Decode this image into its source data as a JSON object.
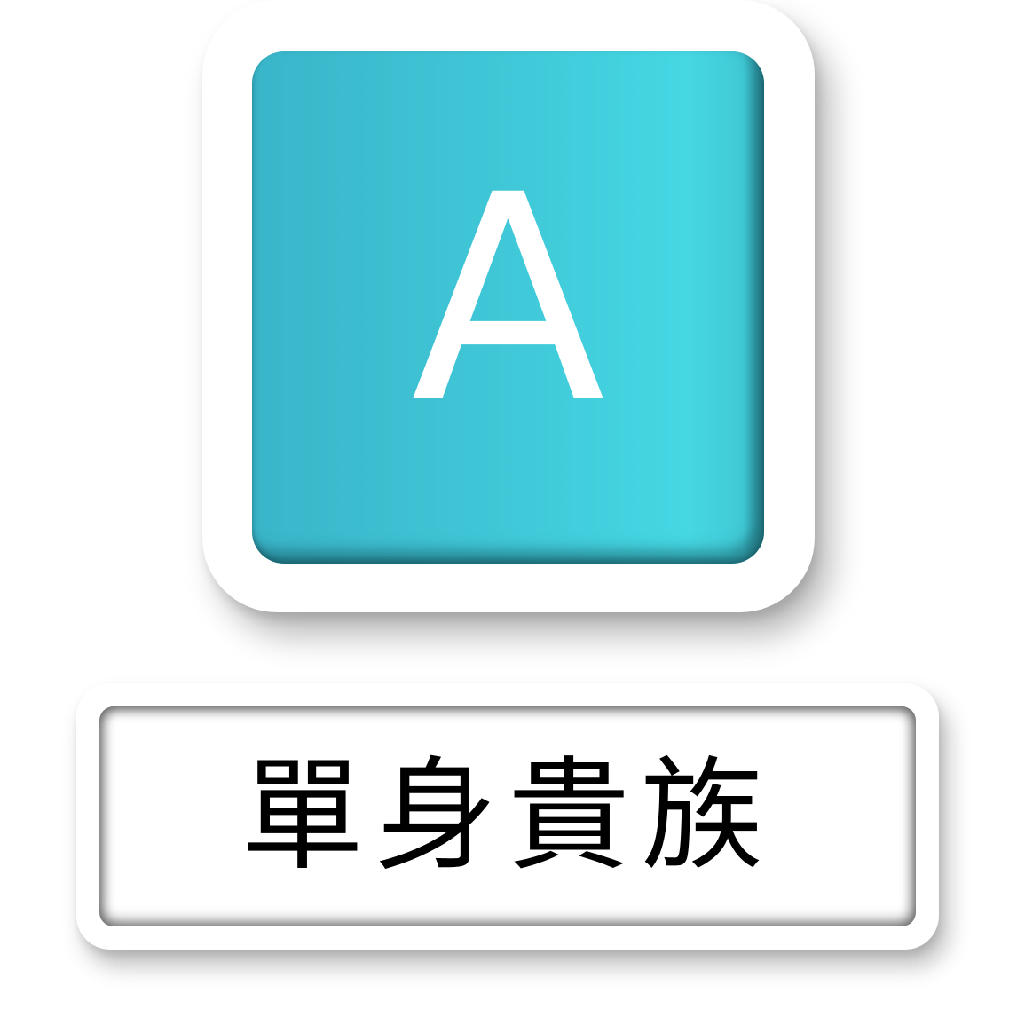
{
  "tile": {
    "letter": "A",
    "face_color_light": "#45d7e3",
    "face_color_dark": "#3ab5c9"
  },
  "label": {
    "text": "單身貴族"
  }
}
